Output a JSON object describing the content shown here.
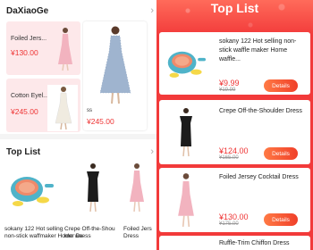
{
  "left": {
    "store_section": {
      "title": "DaXiaoGe",
      "chevron": "chevron-right-icon",
      "cards": [
        {
          "name": "Foiled Jers...",
          "price": "¥130.00"
        },
        {
          "name": "Cotton Eyel...",
          "price": "¥245.00"
        }
      ],
      "featured": {
        "name": "ss",
        "price": "¥245.00"
      }
    },
    "top_list": {
      "title": "Top List",
      "chevron": "chevron-right-icon",
      "items": [
        {
          "name_line1": "sokany 122",
          "name_line2": "non-stick waff"
        },
        {
          "name_line1": "Hot selling",
          "name_line2": "maker Home wa"
        },
        {
          "name_line1": "Crepe Off-the-Shou",
          "name_line2": "lder Dress"
        },
        {
          "name_line1": "Foiled Jers",
          "name_line2": "Dress"
        }
      ]
    }
  },
  "right": {
    "title": "Top List",
    "products": [
      {
        "name": "sokany 122 Hot selling non-stick waffle maker Home waffle...",
        "price": "¥9.99",
        "old_price": "¥19.99",
        "button": "Details"
      },
      {
        "name": "Crepe Off-the-Shoulder Dress",
        "price": "¥124.00",
        "old_price": "¥165.00",
        "button": "Details"
      },
      {
        "name": "Foiled Jersey Cocktail Dress",
        "price": "¥130.00",
        "old_price": "¥175.00",
        "button": "Details"
      },
      {
        "name": "Ruffle-Trim Chiffon Dress"
      }
    ]
  },
  "colors": {
    "accent_red": "#f23a3a",
    "price_red": "#e33333",
    "button_orange": "#f0402a",
    "card_pink": "#fde8ea"
  }
}
